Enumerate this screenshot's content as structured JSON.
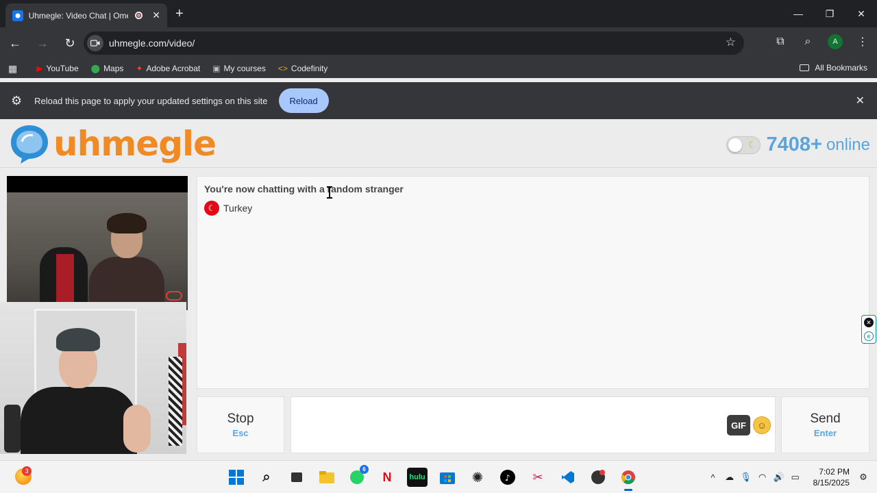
{
  "browser": {
    "tab_title": "Uhmegle: Video Chat | Ome",
    "new_tab": "+",
    "url": "uhmegle.com/video/",
    "profile_initial": "A",
    "bookmarks": [
      {
        "label": "YouTube",
        "icon": "youtube-icon"
      },
      {
        "label": "Maps",
        "icon": "maps-icon"
      },
      {
        "label": "Adobe Acrobat",
        "icon": "acrobat-icon"
      },
      {
        "label": "My courses",
        "icon": "courses-icon"
      },
      {
        "label": "Codefinity",
        "icon": "codefinity-icon"
      }
    ],
    "all_bookmarks": "All Bookmarks"
  },
  "infobar": {
    "message": "Reload this page to apply your updated settings on this site",
    "reload_label": "Reload"
  },
  "site": {
    "logo_text": "uhmegle",
    "online_count": "7408+",
    "online_label": "online",
    "brand_orange": "#f08a24",
    "accent_blue": "#5ba5dd"
  },
  "chat": {
    "status": "You're now chatting with a random stranger",
    "country": "Turkey"
  },
  "controls": {
    "stop_label": "Stop",
    "stop_hint": "Esc",
    "gif_label": "GIF",
    "send_label": "Send",
    "send_hint": "Enter"
  },
  "taskbar": {
    "widget_badge": "3",
    "whatsapp_badge": "6",
    "time": "7:02 PM",
    "date": "8/15/2025"
  }
}
